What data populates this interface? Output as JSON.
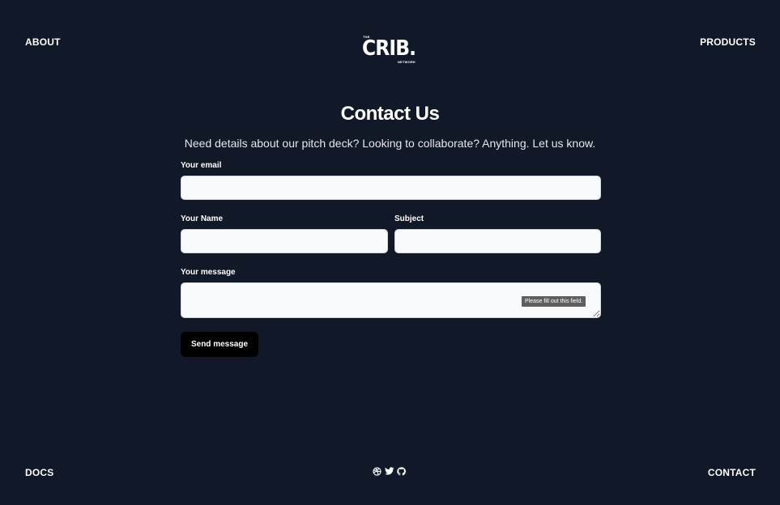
{
  "header": {
    "left_link": "ABOUT",
    "right_link": "PRODUCTS",
    "logo": {
      "top_text": "THE",
      "main_text": "CRIB.",
      "bottom_text": "NETWORK"
    }
  },
  "main": {
    "title": "Contact Us",
    "subtitle": "Need details about our pitch deck? Looking to collaborate? Anything. Let us know.",
    "email_label": "Your email",
    "email_value": "",
    "name_label": "Your Name",
    "name_value": "",
    "subject_label": "Subject",
    "subject_value": "",
    "message_label": "Your message",
    "message_value": "",
    "validation_tooltip": "Please fill out this field.",
    "send_button": "Send message"
  },
  "footer": {
    "left_link": "DOCS",
    "right_link": "CONTACT",
    "social_icons": [
      "dribbble-icon",
      "twitter-icon",
      "github-icon"
    ]
  },
  "colors": {
    "background": "#111827",
    "field_background": "#f9fafb",
    "button_background": "#000000",
    "text": "#ffffff"
  }
}
